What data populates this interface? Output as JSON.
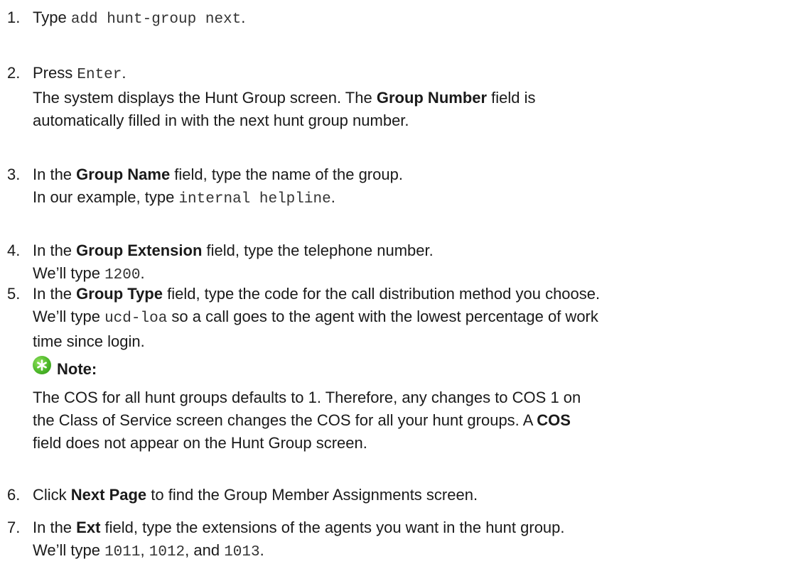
{
  "steps": [
    {
      "num": "1.",
      "pre": "Type ",
      "code": "add hunt-group next",
      "post": "."
    },
    {
      "num": "2.",
      "pre": "Press ",
      "code": "Enter",
      "post": ".",
      "desc_line1_pre": "The system displays the Hunt Group screen. The ",
      "desc_line1_bold": "Group Number",
      "desc_line1_post": " field is",
      "desc_line2": "automatically filled in with the next hunt group number."
    },
    {
      "num": "3.",
      "pre": "In the ",
      "bold": "Group Name",
      "post": " field, type the name of the group.",
      "line2_pre": "In our example, type ",
      "line2_code": "internal helpline",
      "line2_post": "."
    },
    {
      "num": "4.",
      "pre": "In the ",
      "bold": "Group Extension",
      "post": " field, type the telephone number.",
      "line2_pre": "We’ll type ",
      "line2_code": "1200",
      "line2_post": "."
    },
    {
      "num": "5.",
      "pre": "In the ",
      "bold": "Group Type",
      "post": " field, type the code for the call distribution method you choose.",
      "line2_pre": "We’ll type ",
      "line2_code": "ucd-loa",
      "line2_post": " so a call goes to the agent with the lowest percentage of work",
      "line3": "time since login."
    },
    {
      "num": "6.",
      "pre": "Click ",
      "bold": "Next Page",
      "post": " to find the Group Member Assignments screen."
    },
    {
      "num": "7.",
      "pre": "In the ",
      "bold": "Ext",
      "post": " field, type the extensions of the agents you want in the hunt group.",
      "line2_pre": "We’ll type ",
      "code_a": "1011",
      "sep_a": ", ",
      "code_b": "1012",
      "sep_b": ", and ",
      "code_c": "1013",
      "line2_post": "."
    }
  ],
  "note": {
    "title": "Note:",
    "icon": "asterisk-icon",
    "icon_color": "#4db82a",
    "line1": "The COS for all hunt groups defaults to 1. Therefore, any changes to COS 1 on",
    "line2_pre": "the Class of Service screen changes the COS for all your hunt groups. A ",
    "line2_bold": "COS",
    "line3": "field does not appear on the Hunt Group screen."
  }
}
